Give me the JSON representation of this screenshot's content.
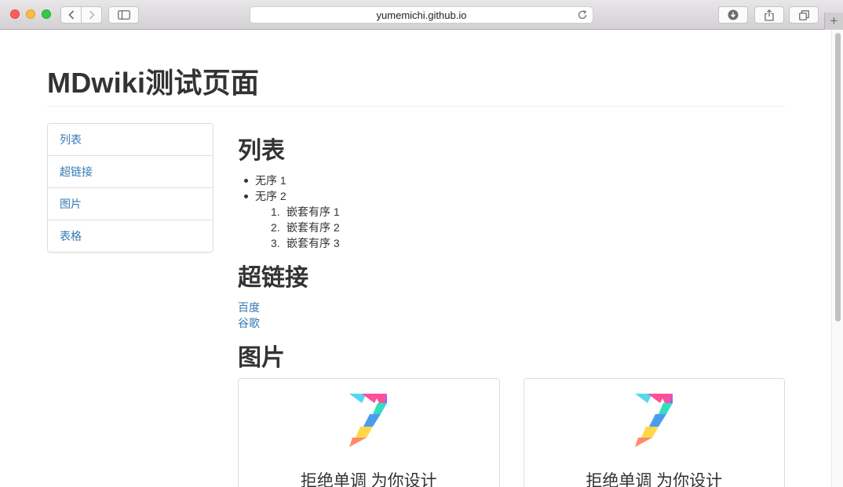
{
  "browser": {
    "url": "yumemichi.github.io",
    "new_tab_symbol": "+"
  },
  "page": {
    "title": "MDwiki测试页面"
  },
  "nav": {
    "items": [
      {
        "label": "列表"
      },
      {
        "label": "超链接"
      },
      {
        "label": "图片"
      },
      {
        "label": "表格"
      }
    ]
  },
  "sections": {
    "list": {
      "heading": "列表",
      "unordered": [
        "无序 1",
        "无序 2"
      ],
      "ordered": [
        {
          "num": "1.",
          "text": "嵌套有序 1"
        },
        {
          "num": "2.",
          "text": "嵌套有序 2"
        },
        {
          "num": "3.",
          "text": "嵌套有序 3"
        }
      ]
    },
    "links": {
      "heading": "超链接",
      "items": [
        "百度",
        "谷歌"
      ]
    },
    "images": {
      "heading": "图片",
      "cards": [
        {
          "caption": "拒绝单调 为你设计",
          "logo": "seven-logo-icon"
        },
        {
          "caption": "拒绝单调 为你设计",
          "logo": "seven-logo-icon"
        }
      ]
    }
  },
  "colors": {
    "link": "#337ab7",
    "text": "#333333",
    "border": "#dddddd"
  }
}
